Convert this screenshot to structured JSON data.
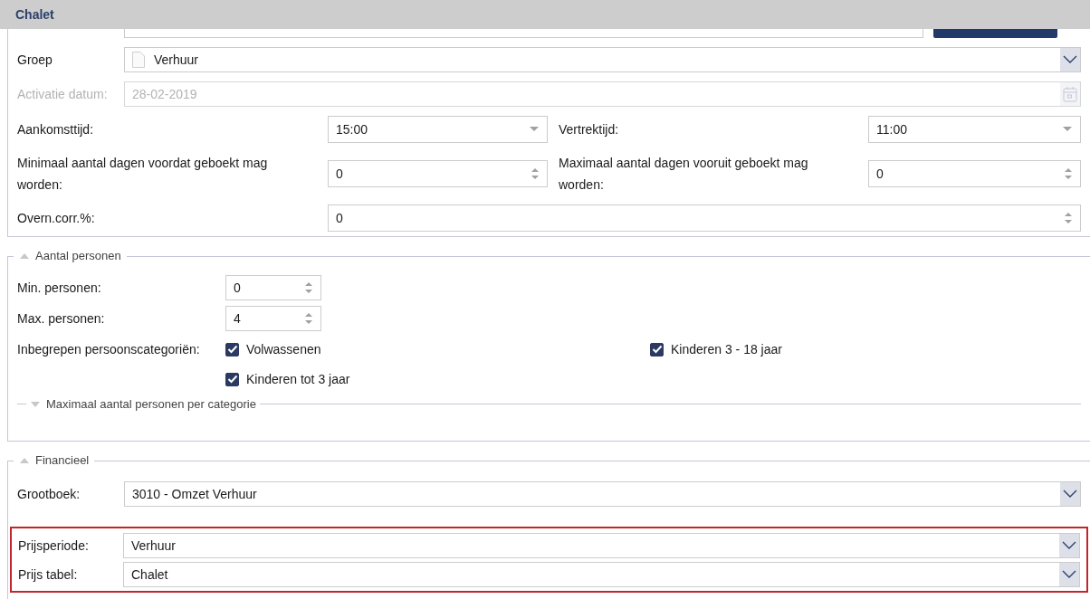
{
  "title": "Chalet",
  "top_fields": [
    {
      "kind": "select-doc",
      "label": "Groep",
      "value": "Verhuur",
      "disabled": false
    },
    {
      "kind": "date",
      "label": "Activatie datum:",
      "value": "28-02-2019",
      "disabled": true
    }
  ],
  "rows": [
    {
      "cells": [
        {
          "kind": "dropdown",
          "label": "Aankomsttijd:",
          "value": "15:00"
        },
        {
          "kind": "dropdown",
          "label": "Vertrektijd:",
          "value": "11:00"
        }
      ]
    },
    {
      "cells": [
        {
          "kind": "spinner",
          "label": "Minimaal aantal dagen voordat geboekt mag worden:",
          "value": "0"
        },
        {
          "kind": "spinner",
          "label": "Maximaal aantal dagen vooruit geboekt mag worden:",
          "value": "0"
        }
      ]
    },
    {
      "cells": [
        {
          "kind": "spinner",
          "label": "Overn.corr.%:",
          "value": "0"
        }
      ]
    }
  ],
  "persons": {
    "title": "Aantal personen",
    "expanded": true,
    "fields": [
      {
        "label": "Min. personen:",
        "value": "0"
      },
      {
        "label": "Max. personen:",
        "value": "4"
      }
    ],
    "categories_label": "Inbegrepen persoonscategoriën:",
    "categories": [
      {
        "label": "Volwassenen",
        "checked": true
      },
      {
        "label": "Kinderen 3 - 18 jaar",
        "checked": true
      },
      {
        "label": "Kinderen tot 3 jaar",
        "checked": true
      }
    ],
    "subsection": {
      "title": "Maximaal aantal personen per categorie",
      "expanded": false
    }
  },
  "financial": {
    "title": "Financieel",
    "expanded": true,
    "ledger": {
      "label": "Grootboek:",
      "value": "3010 - Omzet Verhuur"
    },
    "price_group": {
      "highlighted": true,
      "fields": [
        {
          "label": "Prijsperiode:",
          "value": "Verhuur"
        },
        {
          "label": "Prijs tabel:",
          "value": "Chalet"
        }
      ]
    }
  }
}
